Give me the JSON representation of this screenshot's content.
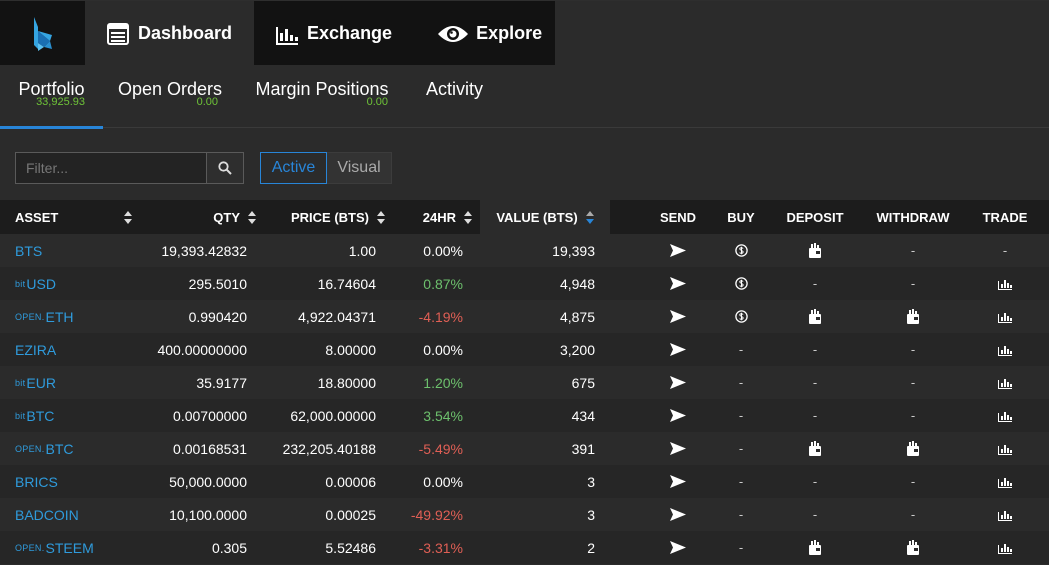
{
  "nav": {
    "items": [
      {
        "label": "Dashboard",
        "icon": "dashboard-icon"
      },
      {
        "label": "Exchange",
        "icon": "exchange-chart-icon"
      },
      {
        "label": "Explore",
        "icon": "eye-icon"
      }
    ]
  },
  "subtabs": [
    {
      "label": "Portfolio",
      "value": "33,925.93"
    },
    {
      "label": "Open Orders",
      "value": "0.00"
    },
    {
      "label": "Margin Positions",
      "value": "0.00"
    },
    {
      "label": "Activity",
      "value": ""
    }
  ],
  "filter": {
    "placeholder": "Filter..."
  },
  "view_toggle": {
    "active": "Active",
    "visual": "Visual"
  },
  "table": {
    "headers": {
      "asset": "ASSET",
      "qty": "QTY",
      "price": "PRICE (BTS)",
      "change": "24HR",
      "value": "VALUE (BTS)",
      "send": "SEND",
      "buy": "BUY",
      "deposit": "DEPOSIT",
      "withdraw": "WITHDRAW",
      "trade": "TRADE"
    },
    "dash": "-",
    "rows": [
      {
        "prefix": "",
        "asset": "BTS",
        "qty": "19,393.42832",
        "price": "1.00",
        "change": "0.00%",
        "trend": "neu",
        "value": "19,393",
        "buy": true,
        "deposit": true,
        "withdraw": false,
        "trade": false
      },
      {
        "prefix": "bit",
        "asset": "USD",
        "qty": "295.5010",
        "price": "16.74604",
        "change": "0.87%",
        "trend": "pos",
        "value": "4,948",
        "buy": true,
        "deposit": false,
        "withdraw": false,
        "trade": true
      },
      {
        "prefix": "OPEN.",
        "asset": "ETH",
        "qty": "0.990420",
        "price": "4,922.04371",
        "change": "-4.19%",
        "trend": "neg",
        "value": "4,875",
        "buy": true,
        "deposit": true,
        "withdraw": true,
        "trade": true
      },
      {
        "prefix": "",
        "asset": "EZIRA",
        "qty": "400.00000000",
        "price": "8.00000",
        "change": "0.00%",
        "trend": "neu",
        "value": "3,200",
        "buy": false,
        "deposit": false,
        "withdraw": false,
        "trade": true
      },
      {
        "prefix": "bit",
        "asset": "EUR",
        "qty": "35.9177",
        "price": "18.80000",
        "change": "1.20%",
        "trend": "pos",
        "value": "675",
        "buy": false,
        "deposit": false,
        "withdraw": false,
        "trade": true
      },
      {
        "prefix": "bit",
        "asset": "BTC",
        "qty": "0.00700000",
        "price": "62,000.00000",
        "change": "3.54%",
        "trend": "pos",
        "value": "434",
        "buy": false,
        "deposit": false,
        "withdraw": false,
        "trade": true
      },
      {
        "prefix": "OPEN.",
        "asset": "BTC",
        "qty": "0.00168531",
        "price": "232,205.40188",
        "change": "-5.49%",
        "trend": "neg",
        "value": "391",
        "buy": false,
        "deposit": true,
        "withdraw": true,
        "trade": true
      },
      {
        "prefix": "",
        "asset": "BRICS",
        "qty": "50,000.0000",
        "price": "0.00006",
        "change": "0.00%",
        "trend": "neu",
        "value": "3",
        "buy": false,
        "deposit": false,
        "withdraw": false,
        "trade": true
      },
      {
        "prefix": "",
        "asset": "BADCOIN",
        "qty": "10,100.0000",
        "price": "0.00025",
        "change": "-49.92%",
        "trend": "neg",
        "value": "3",
        "buy": false,
        "deposit": false,
        "withdraw": false,
        "trade": true
      },
      {
        "prefix": "OPEN.",
        "asset": "STEEM",
        "qty": "0.305",
        "price": "5.52486",
        "change": "-3.31%",
        "trend": "neg",
        "value": "2",
        "buy": false,
        "deposit": true,
        "withdraw": true,
        "trade": true
      }
    ]
  },
  "colors": {
    "accent": "#2885d8",
    "asset_link": "#2f9bdc",
    "positive": "#6dc06d",
    "negative": "#e05f55",
    "subvalue": "#6ec338"
  }
}
